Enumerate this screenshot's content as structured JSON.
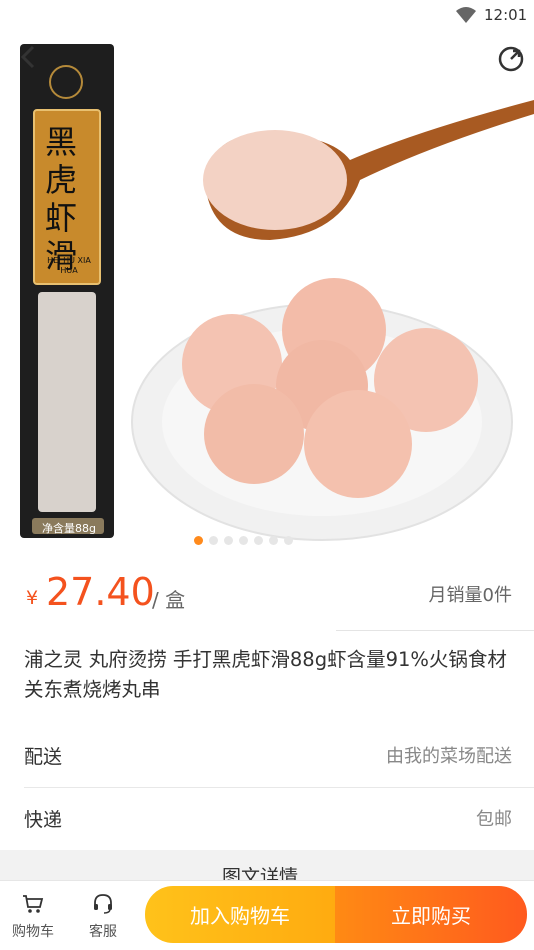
{
  "status_bar": {
    "time": "12:01"
  },
  "gallery": {
    "image_count": 7,
    "active_index": 0
  },
  "product": {
    "currency": "¥",
    "price": "27.40",
    "unit": "/ 盒",
    "monthly_sales": "月销量0件",
    "title": "浦之灵 丸府烫捞 手打黑虎虾滑88g虾含量91%火锅食材关东煮烧烤丸串",
    "package_text": "黑虎虾滑",
    "package_pinyin": "HEI HU XIA HUA",
    "package_weight": "净含量88g"
  },
  "info_rows": [
    {
      "label": "配送",
      "value": "由我的菜场配送"
    },
    {
      "label": "快递",
      "value": "包邮"
    }
  ],
  "detail_section": {
    "label": "图文详情"
  },
  "bottom_bar": {
    "cart_label": "购物车",
    "service_label": "客服",
    "add_to_cart": "加入购物车",
    "buy_now": "立即购买"
  },
  "colors": {
    "accent": "#f4521e",
    "cart_button": "#ffb814",
    "buy_button": "#ff6a1a"
  }
}
